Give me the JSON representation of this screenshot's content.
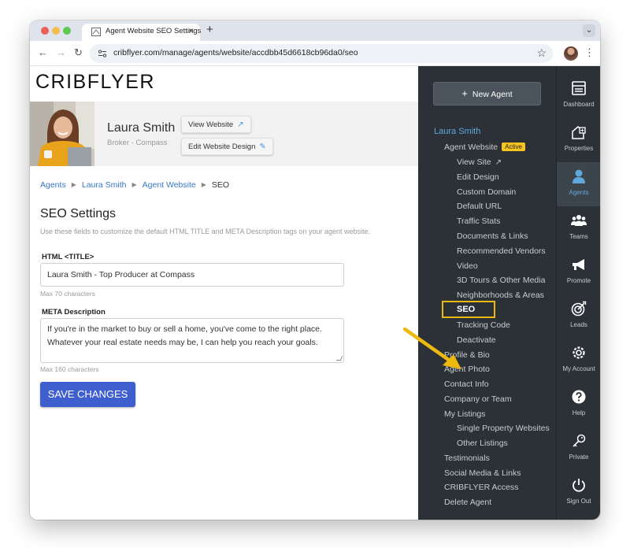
{
  "browser": {
    "tab_title": "Agent Website SEO Settings",
    "tab_close": "×",
    "new_tab": "+",
    "url": "cribflyer.com/manage/agents/website/accdbb45d6618cb96da0/seo"
  },
  "brand": {
    "logo_text": "CRIBFLYER"
  },
  "agent": {
    "name": "Laura Smith",
    "subtitle": "Broker - Compass",
    "view_website_label": "View Website",
    "edit_design_label": "Edit Website Design"
  },
  "breadcrumb": [
    "Agents",
    "Laura Smith",
    "Agent Website",
    "SEO"
  ],
  "form": {
    "heading": "SEO Settings",
    "help": "Use these fields to customize the default HTML TITLE and META Description tags on your agent website.",
    "title_label": "HTML <TITLE>",
    "title_value": "Laura Smith - Top Producer at Compass",
    "title_hint": "Max 70 characters",
    "meta_label": "META Description",
    "meta_value": "If you're in the market to buy or sell a home, you've come to the right place. Whatever your real estate needs may be, I can help you reach your goals.",
    "meta_hint": "Max 160 characters",
    "save_label": "SAVE CHANGES"
  },
  "sidebar": {
    "new_agent_label": "New Agent",
    "agent_name": "Laura Smith",
    "agent_website": "Agent Website",
    "active_badge": "Active",
    "website_items": [
      "View Site",
      "Edit Design",
      "Custom Domain",
      "Default URL",
      "Traffic Stats",
      "Documents & Links",
      "Recommended Vendors",
      "Video",
      "3D Tours & Other Media",
      "Neighborhoods & Areas",
      "SEO",
      "Tracking Code",
      "Deactivate"
    ],
    "items_a": [
      "Profile & Bio",
      "Agent Photo",
      "Contact Info",
      "Company or Team",
      "My Listings"
    ],
    "listing_items": [
      "Single Property Websites",
      "Other Listings"
    ],
    "items_b": [
      "Testimonials",
      "Social Media & Links",
      "CRIBFLYER Access",
      "Delete Agent"
    ]
  },
  "rail": [
    "Dashboard",
    "Properties",
    "Agents",
    "Teams",
    "Promote",
    "Leads",
    "My Account",
    "Help",
    "Private",
    "Sign Out"
  ],
  "colors": {
    "accent": "#3f5fcf",
    "link": "#3a78c9",
    "sidebar_bg": "#2b3136",
    "highlight": "#e8b911"
  }
}
